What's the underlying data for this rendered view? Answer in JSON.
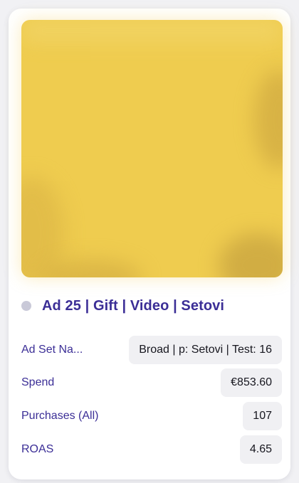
{
  "ad": {
    "title": "Ad 25 | Gift | Video | Setovi",
    "status_color": "#c9c9d8"
  },
  "media": {
    "dominant_color": "#efcc4f"
  },
  "metrics": [
    {
      "label": "Ad Set Na...",
      "value": "Broad | p: Setovi | Test: 16"
    },
    {
      "label": "Spend",
      "value": "€853.60"
    },
    {
      "label": "Purchases (All)",
      "value": "107"
    },
    {
      "label": "ROAS",
      "value": "4.65"
    }
  ],
  "colors": {
    "label": "#3b2e96",
    "value_bg": "#f0f0f3",
    "card_bg": "#ffffff"
  }
}
